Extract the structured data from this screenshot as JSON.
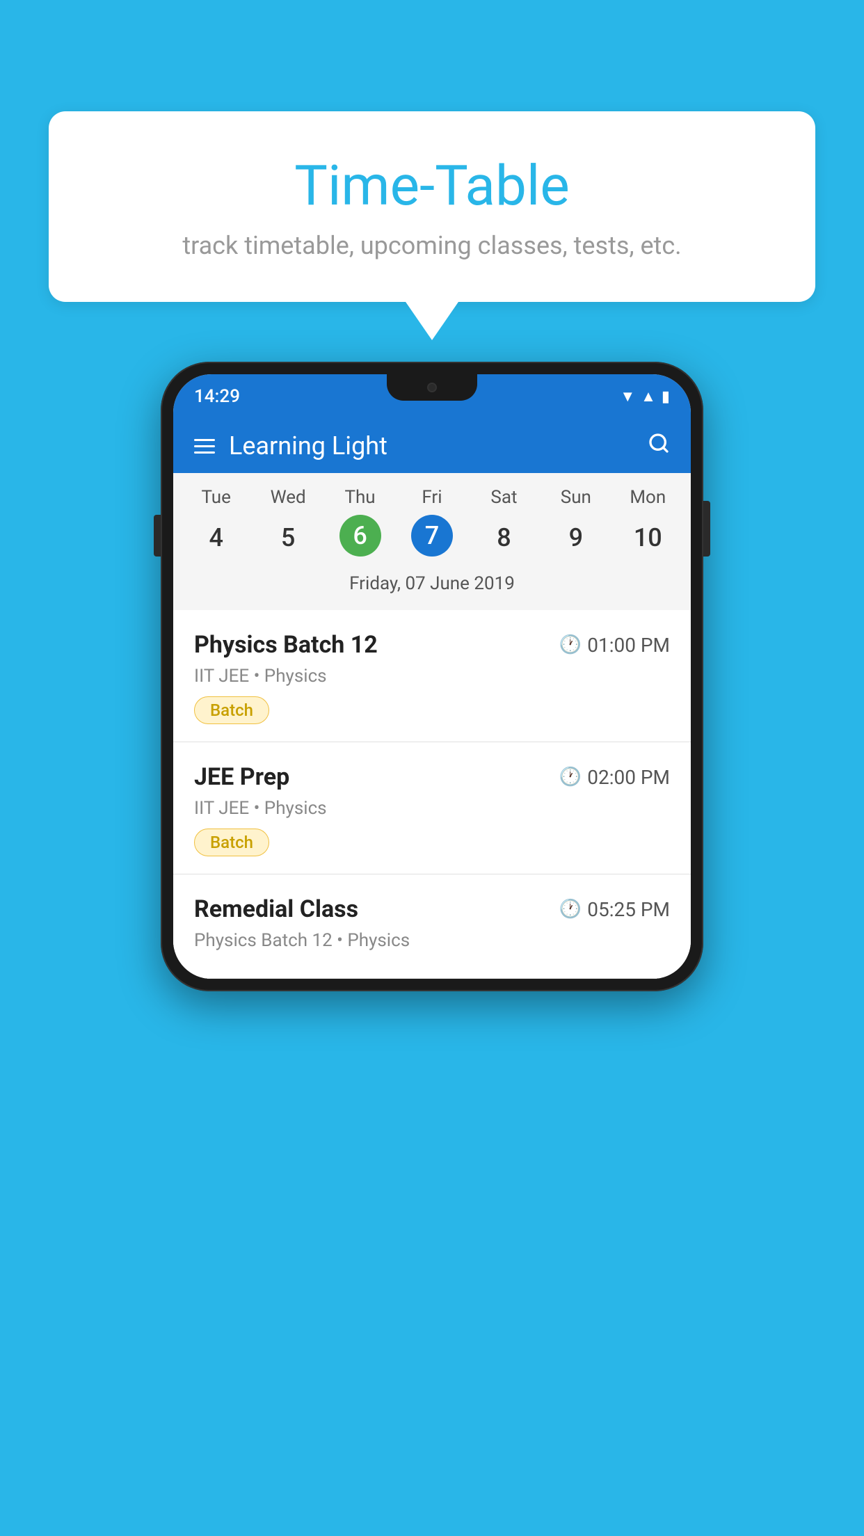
{
  "background_color": "#29b6e8",
  "bubble": {
    "title": "Time-Table",
    "subtitle": "track timetable, upcoming classes, tests, etc."
  },
  "phone": {
    "status_bar": {
      "time": "14:29"
    },
    "app_bar": {
      "title": "Learning Light",
      "menu_icon_label": "menu",
      "search_icon_label": "search"
    },
    "calendar": {
      "days": [
        "Tue",
        "Wed",
        "Thu",
        "Fri",
        "Sat",
        "Sun",
        "Mon"
      ],
      "dates": [
        "4",
        "5",
        "6",
        "7",
        "8",
        "9",
        "10"
      ],
      "today_index": 2,
      "selected_index": 3,
      "date_label": "Friday, 07 June 2019"
    },
    "schedule": [
      {
        "title": "Physics Batch 12",
        "time": "01:00 PM",
        "subtitle": "IIT JEE • Physics",
        "badge": "Batch"
      },
      {
        "title": "JEE Prep",
        "time": "02:00 PM",
        "subtitle": "IIT JEE • Physics",
        "badge": "Batch"
      },
      {
        "title": "Remedial Class",
        "time": "05:25 PM",
        "subtitle": "Physics Batch 12 • Physics",
        "badge": ""
      }
    ]
  }
}
